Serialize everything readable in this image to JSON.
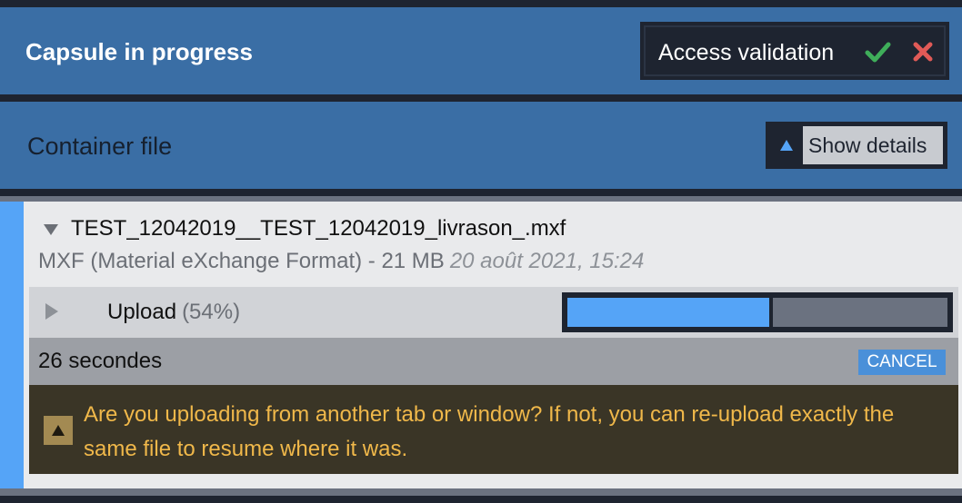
{
  "capsule": {
    "title": "Capsule in progress",
    "access_label": "Access validation",
    "accept_icon": "check-icon",
    "reject_icon": "cross-icon"
  },
  "container": {
    "title": "Container file",
    "details_label": "Show details",
    "details_icon": "triangle-up-icon"
  },
  "file": {
    "name": "TEST_12042019__TEST_12042019_livrason_.mxf",
    "meta": "MXF (Material eXchange Format) - 21 MB",
    "date": "20 août 2021, 15:24",
    "upload_label": "Upload",
    "upload_percent_text": "(54%)",
    "upload_progress": 0.54,
    "remaining": "26 secondes",
    "cancel_label": "CANCEL",
    "warning": "Are you uploading from another tab or window? If not, you can re-upload exactly the same file to resume where it was.",
    "warning_icon": "warning-triangle-icon"
  },
  "colors": {
    "header_blue": "#3a6ea5",
    "accent_blue": "#55a4f7",
    "check_green": "#3fae5a",
    "cross_red": "#e05a57",
    "warning_text": "#f0b84a"
  }
}
